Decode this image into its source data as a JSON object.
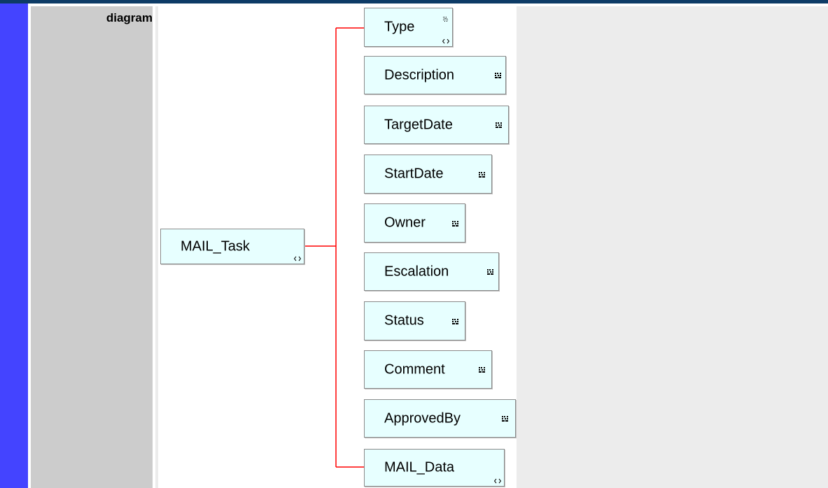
{
  "row": {
    "label": "diagram"
  },
  "diagram": {
    "root": {
      "label": "MAIL_Task",
      "icon": "element-reference-icon"
    },
    "children": [
      {
        "label": "Type",
        "icon": "simple-type-icon",
        "icon2": "element-reference-icon"
      },
      {
        "label": "Description",
        "icon": "attribute-grid-icon"
      },
      {
        "label": "TargetDate",
        "icon": "attribute-grid-icon"
      },
      {
        "label": "StartDate",
        "icon": "attribute-grid-icon"
      },
      {
        "label": "Owner",
        "icon": "attribute-grid-icon"
      },
      {
        "label": "Escalation",
        "icon": "attribute-grid-icon"
      },
      {
        "label": "Status",
        "icon": "attribute-grid-icon"
      },
      {
        "label": "Comment",
        "icon": "attribute-grid-icon"
      },
      {
        "label": "ApprovedBy",
        "icon": "attribute-grid-icon"
      },
      {
        "label": "MAIL_Data",
        "icon": "element-reference-icon"
      }
    ],
    "colors": {
      "connector": "#ff0000",
      "node_fill": "#e7ffff",
      "node_border": "#8a8a8a",
      "left_bar": "#4444ff",
      "top_bar": "#0d3b66",
      "label_cell": "#cccccc",
      "content_cell": "#ececec"
    }
  }
}
